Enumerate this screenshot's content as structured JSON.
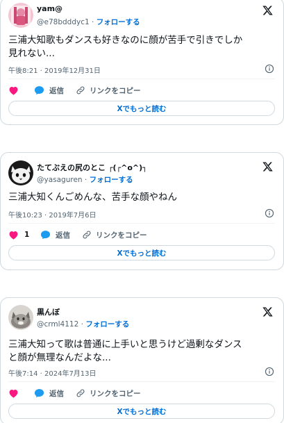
{
  "colors": {
    "link": "#006fd6",
    "text": "#0f1419",
    "muted": "#536471",
    "like": "#f91880",
    "reply": "#1d9bf0",
    "border": "#cfd9de"
  },
  "tweets": [
    {
      "name": "yam@",
      "handle": "@e78bdddyc1",
      "separator": "·",
      "follow_label": "フォローする",
      "text_lines": [
        "三浦大知歌もダンスも好きなのに顔が苦手で引きでしか",
        "見れない..."
      ],
      "timestamp": "午後8:21 · 2019年12月31日",
      "like_count": "",
      "reply_label": "返信",
      "copy_label": "リンクをコピー",
      "read_more_label": "Xでもっと読む",
      "avatar_icon": "user-avatar-pink"
    },
    {
      "name": "たてぶえの尻のとこ ┌(┌^o^)┐",
      "handle": "@yasaguren",
      "separator": "·",
      "follow_label": "フォローする",
      "text_lines": [
        "三浦大知くんごめんな、苦手な顔やねん"
      ],
      "timestamp": "午後10:23 · 2019年7月6日",
      "like_count": "1",
      "reply_label": "返信",
      "copy_label": "リンクをコピー",
      "read_more_label": "Xでもっと読む",
      "avatar_icon": "user-avatar-cat-bw"
    },
    {
      "name": "黒んぼ",
      "handle": "@crml4112",
      "separator": "·",
      "follow_label": "フォローする",
      "text_lines": [
        "三浦大知って歌は普通に上手いと思うけど過剰なダンス",
        "と顔が無理なんだよな..."
      ],
      "timestamp": "午後7:14 · 2024年7月13日",
      "like_count": "",
      "reply_label": "返信",
      "copy_label": "リンクをコピー",
      "read_more_label": "Xでもっと読む",
      "avatar_icon": "user-avatar-cat-gray"
    }
  ]
}
